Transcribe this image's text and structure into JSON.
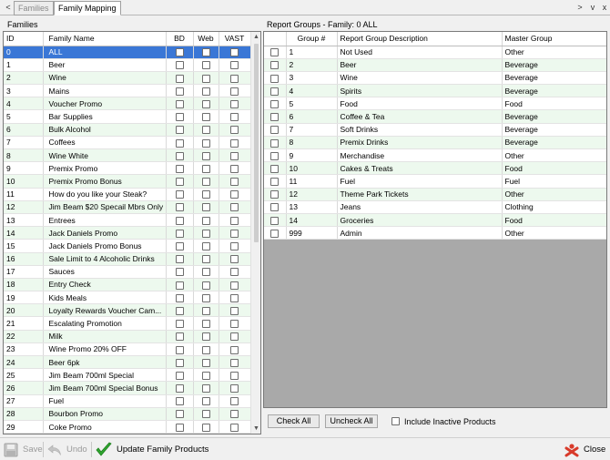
{
  "tabs": {
    "prev_arrow": "<",
    "items": [
      {
        "label": "Families",
        "state": "inactive"
      },
      {
        "label": "Family Mapping",
        "state": "active"
      }
    ],
    "next_arrow": ">",
    "menu": "v",
    "close": "x"
  },
  "families": {
    "heading": "Families",
    "columns": [
      "ID",
      "Family Name",
      "BD",
      "Web",
      "VAST"
    ],
    "rows": [
      {
        "id": "0",
        "name": "ALL"
      },
      {
        "id": "1",
        "name": "Beer"
      },
      {
        "id": "2",
        "name": "Wine"
      },
      {
        "id": "3",
        "name": "Mains"
      },
      {
        "id": "4",
        "name": "Voucher Promo"
      },
      {
        "id": "5",
        "name": "Bar Supplies"
      },
      {
        "id": "6",
        "name": "Bulk Alcohol"
      },
      {
        "id": "7",
        "name": "Coffees"
      },
      {
        "id": "8",
        "name": "Wine White"
      },
      {
        "id": "9",
        "name": "Premix Promo"
      },
      {
        "id": "10",
        "name": "Premix Promo Bonus"
      },
      {
        "id": "11",
        "name": "How do you like your Steak?"
      },
      {
        "id": "12",
        "name": "Jim Beam $20 Specail Mbrs Only"
      },
      {
        "id": "13",
        "name": "Entrees"
      },
      {
        "id": "14",
        "name": "Jack Daniels Promo"
      },
      {
        "id": "15",
        "name": "Jack Daniels Promo Bonus"
      },
      {
        "id": "16",
        "name": "Sale Limit to 4 Alcoholic Drinks"
      },
      {
        "id": "17",
        "name": "Sauces"
      },
      {
        "id": "18",
        "name": "Entry Check"
      },
      {
        "id": "19",
        "name": "Kids Meals"
      },
      {
        "id": "20",
        "name": "Loyalty Rewards Voucher Cam..."
      },
      {
        "id": "21",
        "name": "Escalating Promotion"
      },
      {
        "id": "22",
        "name": "Milk"
      },
      {
        "id": "23",
        "name": "Wine Promo 20% OFF"
      },
      {
        "id": "24",
        "name": "Beer 6pk"
      },
      {
        "id": "25",
        "name": "Jim Beam 700ml Special"
      },
      {
        "id": "26",
        "name": "Jim Beam 700ml Special Bonus"
      },
      {
        "id": "27",
        "name": "Fuel"
      },
      {
        "id": "28",
        "name": "Bourbon Promo"
      },
      {
        "id": "29",
        "name": "Coke Promo"
      }
    ]
  },
  "report_groups": {
    "heading": "Report Groups - Family: 0 ALL",
    "columns": [
      "",
      "Group #",
      "Report Group Description",
      "Master Group"
    ],
    "rows": [
      {
        "num": "1",
        "desc": "Not Used",
        "master": "Other"
      },
      {
        "num": "2",
        "desc": "Beer",
        "master": "Beverage"
      },
      {
        "num": "3",
        "desc": "Wine",
        "master": "Beverage"
      },
      {
        "num": "4",
        "desc": "Spirits",
        "master": "Beverage"
      },
      {
        "num": "5",
        "desc": "Food",
        "master": "Food"
      },
      {
        "num": "6",
        "desc": "Coffee & Tea",
        "master": "Beverage"
      },
      {
        "num": "7",
        "desc": "Soft Drinks",
        "master": "Beverage"
      },
      {
        "num": "8",
        "desc": "Premix Drinks",
        "master": "Beverage"
      },
      {
        "num": "9",
        "desc": "Merchandise",
        "master": "Other"
      },
      {
        "num": "10",
        "desc": "Cakes & Treats",
        "master": "Food"
      },
      {
        "num": "11",
        "desc": "Fuel",
        "master": "Fuel"
      },
      {
        "num": "12",
        "desc": "Theme Park Tickets",
        "master": "Other"
      },
      {
        "num": "13",
        "desc": "Jeans",
        "master": "Clothing"
      },
      {
        "num": "14",
        "desc": "Groceries",
        "master": "Food"
      },
      {
        "num": "999",
        "desc": "Admin",
        "master": "Other"
      }
    ]
  },
  "buttons": {
    "check_all": "Check All",
    "uncheck_all": "Uncheck All",
    "include_inactive": "Include Inactive Products"
  },
  "toolbar": {
    "save": "Save",
    "undo": "Undo",
    "update": "Update Family Products",
    "close": "Close"
  },
  "colors": {
    "selection": "#3a77d6",
    "alt_row": "#edf9ee",
    "empty_area": "#a9a9a9",
    "update_check": "#2fa52f",
    "close_icon": "#d83a2a"
  }
}
